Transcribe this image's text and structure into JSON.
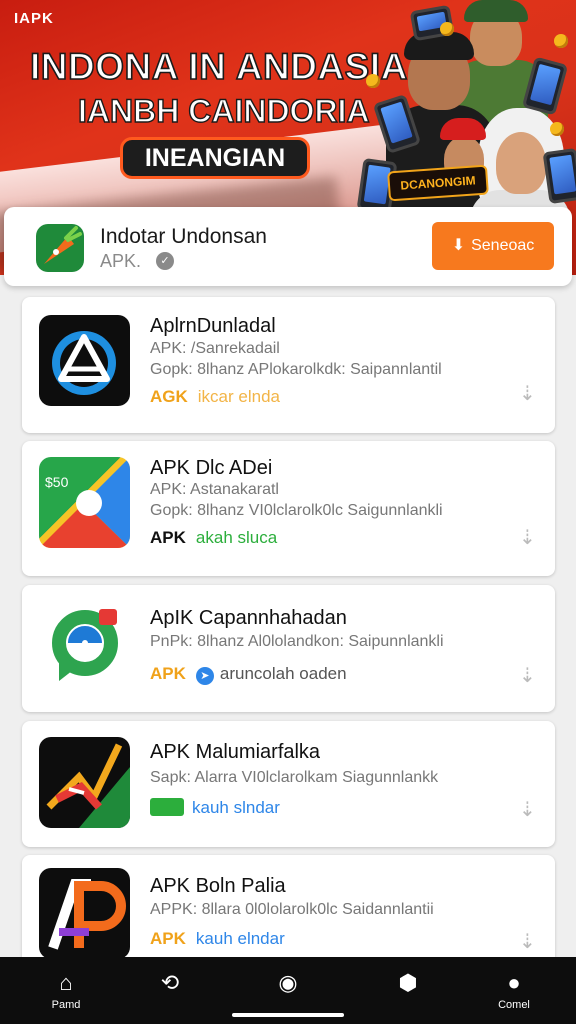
{
  "banner": {
    "corner_tag": "IAPK",
    "title_line1": "INDONA IN ANDASIA",
    "title_line2": "IANBH CAINDORIA",
    "pill_label": "INEANGIAN",
    "badge_label": "DCANONGIM",
    "colors": {
      "background": "#d8321a",
      "pill_border": "#ff5a1e"
    }
  },
  "featured": {
    "name": "Indotar Undonsan",
    "subtitle": "APK.",
    "cta_label": "Seneoac",
    "cta_color": "#f7791e",
    "icon": "carrot-app-icon"
  },
  "apps": [
    {
      "title": "AplrnDunladal",
      "line1": "APK: /Sanrekadail",
      "line2": "Gopk: 8lhanz APlokarolkdk: Saipannlantil",
      "tag_a": "AGK",
      "tag_b": "ikcar elnda",
      "icon": "triangle-gear-app-icon"
    },
    {
      "title": "APK Dlc ADei",
      "line1": "APK: Astanakaratl",
      "line2": "Gopk: 8lhanz VI0lclarolk0lc Saigunnlankli",
      "tag_a": "APK",
      "tag_b": "akah sluca",
      "icon": "colorful-circle-app-icon"
    },
    {
      "title": "ApIK Capannhahadan",
      "line1": "PnPk: 8lhanz Al0lolandkon: Saipunnlankli",
      "line2": "",
      "tag_a": "APK",
      "tag_b": "aruncolah   oaden",
      "icon": "location-pin-app-icon"
    },
    {
      "title": "APK Malumiarfalka",
      "line1": "Sapk: Alarra VI0lclarolkam Siagunnlankk",
      "line2": "",
      "tag_a": "",
      "tag_b": "kauh slndar",
      "icon": "chart-swoosh-app-icon"
    },
    {
      "title": "APK Boln Palia",
      "line1": "APPK: 8llara 0l0lolarolk0lc Saidannlantii",
      "line2": "",
      "tag_a": "APK",
      "tag_b": "kauh elndar",
      "icon": "ap-letters-app-icon"
    }
  ],
  "nav": {
    "items": [
      {
        "label": "Pamd",
        "icon": "home-icon"
      },
      {
        "label": "",
        "icon": "search-icon"
      },
      {
        "label": "",
        "icon": "circle-icon"
      },
      {
        "label": "",
        "icon": "hexagon-icon"
      },
      {
        "label": "Comel",
        "icon": "profile-icon"
      }
    ]
  }
}
